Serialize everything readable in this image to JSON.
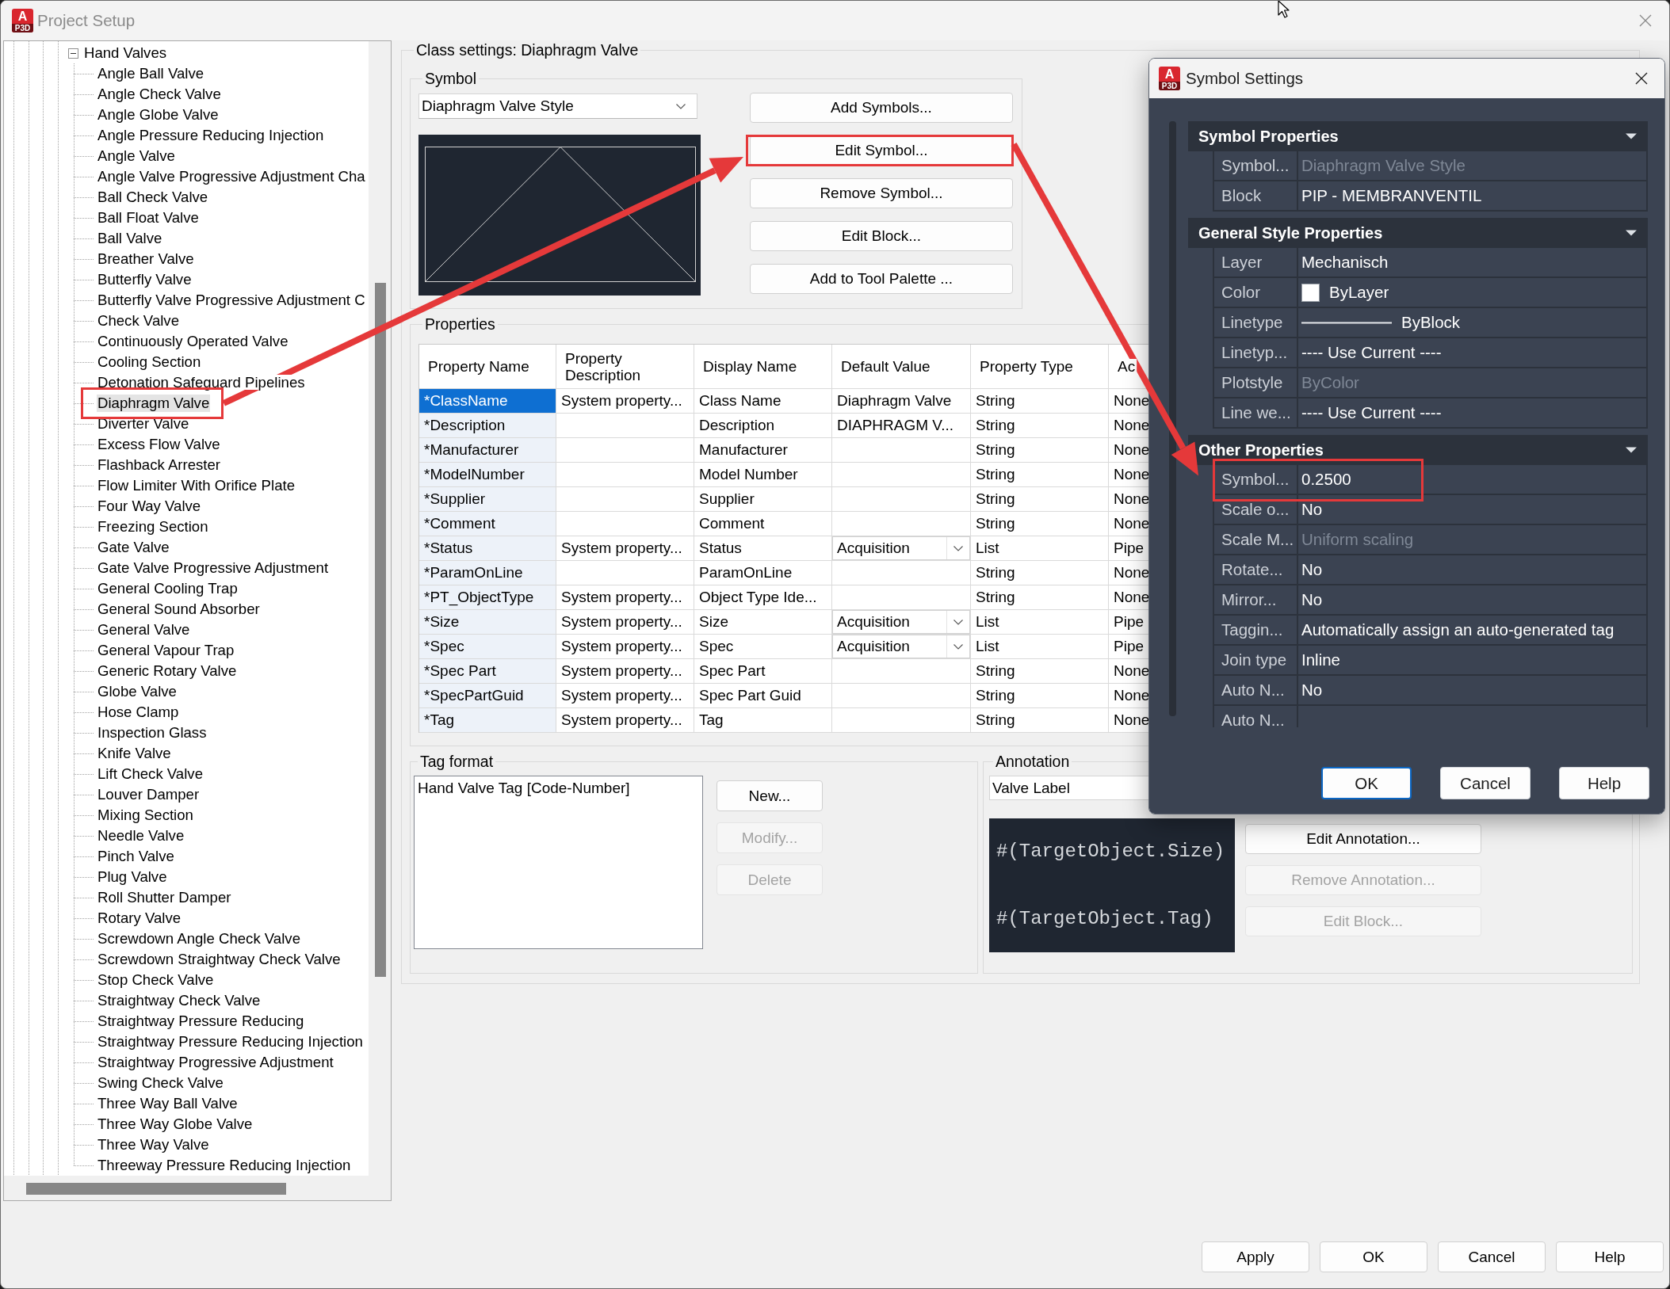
{
  "window": {
    "title": "Project Setup",
    "logo": {
      "letter": "A",
      "badge": "P3D"
    }
  },
  "tree": [
    {
      "label": "Hand Valves",
      "expanded": true,
      "selected": false,
      "highlighted": false,
      "children": [
        {
          "label": "Angle Ball Valve",
          "selected": false,
          "highlighted": false
        },
        {
          "label": "Angle Check Valve",
          "selected": false,
          "highlighted": false
        },
        {
          "label": "Angle Globe Valve",
          "selected": false,
          "highlighted": false
        },
        {
          "label": "Angle Pressure Reducing Injection",
          "selected": false,
          "highlighted": false
        },
        {
          "label": "Angle Valve",
          "selected": false,
          "highlighted": false
        },
        {
          "label": "Angle Valve Progressive Adjustment Cha",
          "selected": false,
          "highlighted": false
        },
        {
          "label": "Ball Check Valve",
          "selected": false,
          "highlighted": false
        },
        {
          "label": "Ball Float Valve",
          "selected": false,
          "highlighted": false
        },
        {
          "label": "Ball Valve",
          "selected": false,
          "highlighted": false
        },
        {
          "label": "Breather Valve",
          "selected": false,
          "highlighted": false
        },
        {
          "label": "Butterfly Valve",
          "selected": false,
          "highlighted": false
        },
        {
          "label": "Butterfly Valve Progressive Adjustment C",
          "selected": false,
          "highlighted": false
        },
        {
          "label": "Check Valve",
          "selected": false,
          "highlighted": false
        },
        {
          "label": "Continuously Operated Valve",
          "selected": false,
          "highlighted": false
        },
        {
          "label": "Cooling Section",
          "selected": false,
          "highlighted": false
        },
        {
          "label": "Detonation Safeguard Pipelines",
          "selected": false,
          "highlighted": false
        },
        {
          "label": "Diaphragm Valve",
          "selected": true,
          "highlighted": true
        },
        {
          "label": "Diverter Valve",
          "selected": false,
          "highlighted": false
        },
        {
          "label": "Excess Flow Valve",
          "selected": false,
          "highlighted": false
        },
        {
          "label": "Flashback Arrester",
          "selected": false,
          "highlighted": false
        },
        {
          "label": "Flow Limiter With Orifice Plate",
          "selected": false,
          "highlighted": false
        },
        {
          "label": "Four Way Valve",
          "selected": false,
          "highlighted": false
        },
        {
          "label": "Freezing Section",
          "selected": false,
          "highlighted": false
        },
        {
          "label": "Gate Valve",
          "selected": false,
          "highlighted": false
        },
        {
          "label": "Gate Valve Progressive Adjustment",
          "selected": false,
          "highlighted": false
        },
        {
          "label": "General Cooling Trap",
          "selected": false,
          "highlighted": false
        },
        {
          "label": "General Sound Absorber",
          "selected": false,
          "highlighted": false
        },
        {
          "label": "General Valve",
          "selected": false,
          "highlighted": false
        },
        {
          "label": "General Vapour Trap",
          "selected": false,
          "highlighted": false
        },
        {
          "label": "Generic Rotary Valve",
          "selected": false,
          "highlighted": false
        },
        {
          "label": "Globe Valve",
          "selected": false,
          "highlighted": false
        },
        {
          "label": "Hose Clamp",
          "selected": false,
          "highlighted": false
        },
        {
          "label": "Inspection Glass",
          "selected": false,
          "highlighted": false
        },
        {
          "label": "Knife Valve",
          "selected": false,
          "highlighted": false
        },
        {
          "label": "Lift Check Valve",
          "selected": false,
          "highlighted": false
        },
        {
          "label": "Louver Damper",
          "selected": false,
          "highlighted": false
        },
        {
          "label": "Mixing Section",
          "selected": false,
          "highlighted": false
        },
        {
          "label": "Needle Valve",
          "selected": false,
          "highlighted": false
        },
        {
          "label": "Pinch Valve",
          "selected": false,
          "highlighted": false
        },
        {
          "label": "Plug Valve",
          "selected": false,
          "highlighted": false
        },
        {
          "label": "Roll Shutter Damper",
          "selected": false,
          "highlighted": false
        },
        {
          "label": "Rotary Valve",
          "selected": false,
          "highlighted": false
        },
        {
          "label": "Screwdown Angle Check Valve",
          "selected": false,
          "highlighted": false
        },
        {
          "label": "Screwdown Straightway Check Valve",
          "selected": false,
          "highlighted": false
        },
        {
          "label": "Stop Check Valve",
          "selected": false,
          "highlighted": false
        },
        {
          "label": "Straightway Check Valve",
          "selected": false,
          "highlighted": false
        },
        {
          "label": "Straightway Pressure Reducing",
          "selected": false,
          "highlighted": false
        },
        {
          "label": "Straightway Pressure Reducing Injection",
          "selected": false,
          "highlighted": false
        },
        {
          "label": "Straightway Progressive Adjustment",
          "selected": false,
          "highlighted": false
        },
        {
          "label": "Swing Check Valve",
          "selected": false,
          "highlighted": false
        },
        {
          "label": "Three Way Ball Valve",
          "selected": false,
          "highlighted": false
        },
        {
          "label": "Three Way Globe Valve",
          "selected": false,
          "highlighted": false
        },
        {
          "label": "Three Way Valve",
          "selected": false,
          "highlighted": false
        },
        {
          "label": "Threeway Pressure Reducing Injection",
          "selected": false,
          "highlighted": false
        }
      ]
    }
  ],
  "class_settings": {
    "title": "Class settings: Diaphragm Valve",
    "symbol": {
      "label": "Symbol",
      "style": "Diaphragm Valve Style",
      "buttons": [
        {
          "label": "Add Symbols...",
          "highlighted": false
        },
        {
          "label": "Edit Symbol...",
          "highlighted": true
        },
        {
          "label": "Remove Symbol...",
          "highlighted": false
        },
        {
          "label": "Edit Block...",
          "highlighted": false
        },
        {
          "label": "Add to Tool Palette ...",
          "highlighted": false
        }
      ]
    },
    "properties": {
      "label": "Properties",
      "columns": [
        "Property Name",
        "Property Description",
        "Display Name",
        "Default Value",
        "Property Type",
        "Ac"
      ],
      "rows": [
        {
          "property_name": "*ClassName",
          "property_description": "System property...",
          "display_name": "Class Name",
          "default_value": "Diaphragm Valve",
          "property_type": "String",
          "column_6": "None",
          "dropdown": false,
          "selected": true
        },
        {
          "property_name": "*Description",
          "display_name": "Description",
          "default_value": "DIAPHRAGM V...",
          "property_type": "String",
          "column_6": "None",
          "dropdown": false,
          "selected": false
        },
        {
          "property_name": "*Manufacturer",
          "display_name": "Manufacturer",
          "property_type": "String",
          "column_6": "None",
          "dropdown": false,
          "selected": false
        },
        {
          "property_name": "*ModelNumber",
          "display_name": "Model Number",
          "property_type": "String",
          "column_6": "None",
          "dropdown": false,
          "selected": false
        },
        {
          "property_name": "*Supplier",
          "display_name": "Supplier",
          "property_type": "String",
          "column_6": "None",
          "dropdown": false,
          "selected": false
        },
        {
          "property_name": "*Comment",
          "display_name": "Comment",
          "property_type": "String",
          "column_6": "None",
          "dropdown": false,
          "selected": false
        },
        {
          "property_name": "*Status",
          "property_description": "System property...",
          "display_name": "Status",
          "default_value": "Acquisition",
          "property_type": "List",
          "column_6": "Pipe",
          "dropdown": true,
          "selected": false
        },
        {
          "property_name": "*ParamOnLine",
          "display_name": "ParamOnLine",
          "property_type": "String",
          "column_6": "None",
          "dropdown": false,
          "selected": false
        },
        {
          "property_name": "*PT_ObjectType",
          "property_description": "System property...",
          "display_name": "Object Type Ide...",
          "property_type": "String",
          "column_6": "None",
          "dropdown": false,
          "selected": false
        },
        {
          "property_name": "*Size",
          "property_description": "System property...",
          "display_name": "Size",
          "default_value": "Acquisition",
          "property_type": "List",
          "column_6": "Pipe",
          "dropdown": true,
          "selected": false
        },
        {
          "property_name": "*Spec",
          "property_description": "System property...",
          "display_name": "Spec",
          "default_value": "Acquisition",
          "property_type": "List",
          "column_6": "Pipe",
          "dropdown": true,
          "selected": false
        },
        {
          "property_name": "*Spec Part",
          "property_description": "System property...",
          "display_name": "Spec Part",
          "property_type": "String",
          "column_6": "None",
          "dropdown": false,
          "selected": false
        },
        {
          "property_name": "*SpecPartGuid",
          "property_description": "System property...",
          "display_name": "Spec Part Guid",
          "property_type": "String",
          "column_6": "None",
          "dropdown": false,
          "selected": false
        },
        {
          "property_name": "*Tag",
          "property_description": "System property...",
          "display_name": "Tag",
          "property_type": "String",
          "column_6": "None",
          "dropdown": false,
          "selected": false
        }
      ]
    },
    "tag_format": {
      "label": "Tag format",
      "items": [
        {
          "label": "Hand Valve Tag [Code-Number]",
          "selected": false
        }
      ],
      "buttons": [
        {
          "label": "New...",
          "disabled": false
        },
        {
          "label": "Modify...",
          "disabled": true
        },
        {
          "label": "Delete",
          "disabled": true
        }
      ]
    },
    "annotation": {
      "label": "Annotation",
      "style": "Valve Label",
      "preview": [
        "#(TargetObject.Size)",
        "#(TargetObject.Tag)"
      ],
      "buttons": [
        {
          "label": "Edit Annotation...",
          "disabled": false
        },
        {
          "label": "Remove Annotation...",
          "disabled": true
        },
        {
          "label": "Edit Block...",
          "disabled": true
        }
      ]
    }
  },
  "symbol_settings": {
    "title": "Symbol Settings",
    "logo": {
      "letter": "A",
      "badge": "P3D"
    },
    "sections": [
      {
        "title": "Symbol Properties",
        "expanded": true,
        "rows": [
          {
            "name": "Symbol...",
            "value": "Diaphragm Valve Style",
            "kind": "text",
            "disabled": true,
            "highlighted": false
          },
          {
            "name": "Block",
            "value": "PIP - MEMBRANVENTIL",
            "kind": "text",
            "disabled": false,
            "highlighted": false
          }
        ]
      },
      {
        "title": "General Style Properties",
        "expanded": true,
        "rows": [
          {
            "name": "Layer",
            "value": "Mechanisch",
            "kind": "text",
            "disabled": false,
            "highlighted": false
          },
          {
            "name": "Color",
            "value": "ByLayer",
            "kind": "color",
            "color": "#ffffff",
            "disabled": false,
            "highlighted": false
          },
          {
            "name": "Linetype",
            "value": "ByBlock",
            "kind": "linetype",
            "disabled": false,
            "highlighted": false
          },
          {
            "name": "Linetyp...",
            "value": "---- Use Current ----",
            "kind": "text",
            "disabled": false,
            "highlighted": false
          },
          {
            "name": "Plotstyle",
            "value": "ByColor",
            "kind": "text",
            "disabled": true,
            "highlighted": false
          },
          {
            "name": "Line we...",
            "value": "---- Use Current ----",
            "kind": "text",
            "disabled": false,
            "highlighted": false
          }
        ]
      },
      {
        "title": "Other Properties",
        "expanded": true,
        "rows": [
          {
            "name": "Symbol...",
            "value": "0.2500",
            "kind": "text",
            "disabled": false,
            "highlighted": true
          },
          {
            "name": "Scale o...",
            "value": "No",
            "kind": "text",
            "disabled": false,
            "highlighted": false
          },
          {
            "name": "Scale M...",
            "value": "Uniform scaling",
            "kind": "text",
            "disabled": true,
            "highlighted": false
          },
          {
            "name": "Rotate...",
            "value": "No",
            "kind": "text",
            "disabled": false,
            "highlighted": false
          },
          {
            "name": "Mirror...",
            "value": "No",
            "kind": "text",
            "disabled": false,
            "highlighted": false
          },
          {
            "name": "Taggin...",
            "value": "Automatically assign an auto-generated tag",
            "kind": "text",
            "disabled": false,
            "highlighted": false
          },
          {
            "name": "Join type",
            "value": "Inline",
            "kind": "text",
            "disabled": false,
            "highlighted": false
          },
          {
            "name": "Auto N...",
            "value": "No",
            "kind": "text",
            "disabled": false,
            "highlighted": false
          },
          {
            "name": "Auto N...",
            "kind": "text",
            "highlighted": false
          }
        ]
      }
    ],
    "buttons": [
      {
        "label": "OK",
        "default": true
      },
      {
        "label": "Cancel",
        "default": false
      },
      {
        "label": "Help",
        "default": false
      }
    ]
  },
  "buttons": [
    "Apply",
    "OK",
    "Cancel",
    "Help"
  ]
}
